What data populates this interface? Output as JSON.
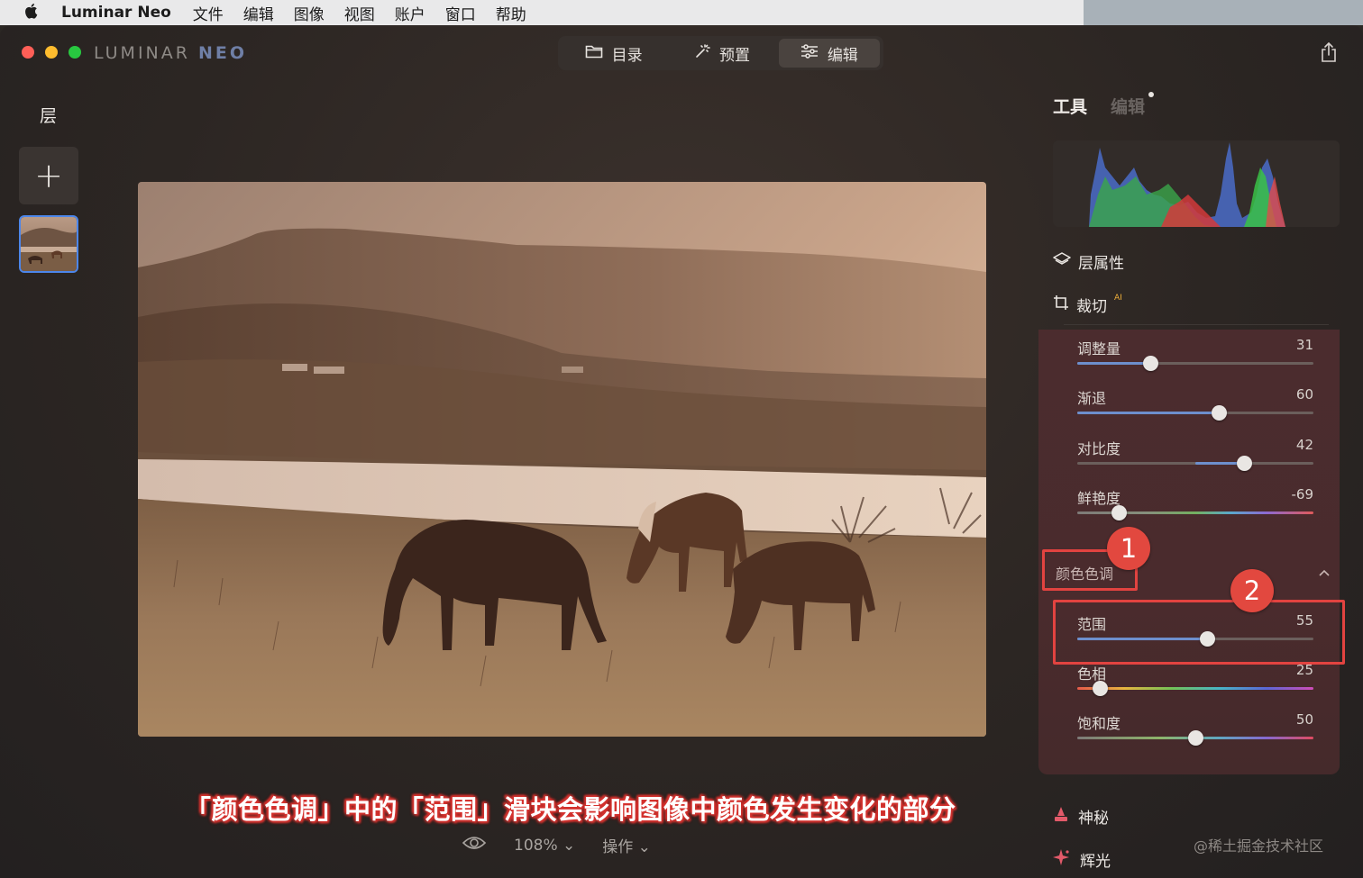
{
  "menubar": {
    "apple": "",
    "app_name": "Luminar Neo",
    "items": [
      "文件",
      "编辑",
      "图像",
      "视图",
      "账户",
      "窗口",
      "帮助"
    ]
  },
  "window": {
    "logo_main": "LUMINAR",
    "logo_neo": "NEO",
    "modes": [
      {
        "label": "目录",
        "icon": "folder-icon"
      },
      {
        "label": "预置",
        "icon": "sparkle-icon"
      },
      {
        "label": "编辑",
        "icon": "sliders-icon",
        "active": true
      }
    ]
  },
  "left_panel": {
    "title": "层",
    "add_label": "+"
  },
  "viewer": {
    "zoom": "108%",
    "actions": "操作",
    "caption": "「颜色色调」中的「范围」滑块会影响图像中颜色发生变化的部分"
  },
  "right_panel": {
    "tab_tools": "工具",
    "tab_edits": "编辑",
    "layer_props": "层属性",
    "crop": "裁切",
    "crop_badge": "AI",
    "sliders_top": [
      {
        "label": "调整量",
        "value": "31",
        "fraction": 0.31,
        "style": "fill"
      },
      {
        "label": "渐退",
        "value": "60",
        "fraction": 0.6,
        "style": "fill"
      },
      {
        "label": "对比度",
        "value": "42",
        "fraction": 0.705,
        "style": "contrast"
      },
      {
        "label": "鲜艳度",
        "value": "-69",
        "fraction": 0.175,
        "style": "vib"
      }
    ],
    "section_title": "颜色色调",
    "sliders_color": [
      {
        "label": "范围",
        "value": "55",
        "fraction": 0.55,
        "style": "fill"
      },
      {
        "label": "色相",
        "value": "25",
        "fraction": 0.095,
        "style": "hue"
      },
      {
        "label": "饱和度",
        "value": "50",
        "fraction": 0.5,
        "style": "sat"
      }
    ],
    "badge_1": "1",
    "badge_2": "2",
    "tools_below": [
      {
        "label": "神秘",
        "icon": "mystical-icon"
      },
      {
        "label": "辉光",
        "icon": "glow-icon"
      }
    ]
  },
  "watermark": "@稀土掘金技术社区",
  "colors": {
    "accent_blue": "#6d8fcd",
    "annotation_red": "#e24340",
    "panel_bg": "#4b2c2e"
  }
}
